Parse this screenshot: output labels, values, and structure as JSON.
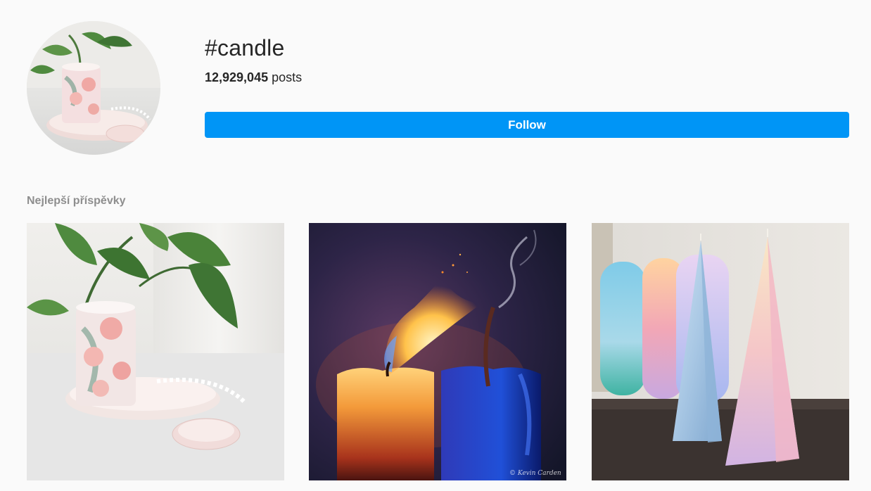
{
  "hashtag": {
    "title": "#candle",
    "post_count": "12,929,045",
    "post_count_suffix": " posts",
    "follow_label": "Follow"
  },
  "top_posts": {
    "heading": "Nejlepší příspěvky",
    "items": [
      {
        "name": "post-pink-floral-candle",
        "subject": "photo"
      },
      {
        "name": "post-two-candles-flame",
        "subject": "photo",
        "watermark": "© Kevin Carden"
      },
      {
        "name": "post-pastel-pyramid-candles",
        "subject": "photo"
      }
    ]
  },
  "colors": {
    "accent": "#0095f6",
    "background": "#fafafa",
    "text": "#262626",
    "muted": "#8e8e8e"
  }
}
